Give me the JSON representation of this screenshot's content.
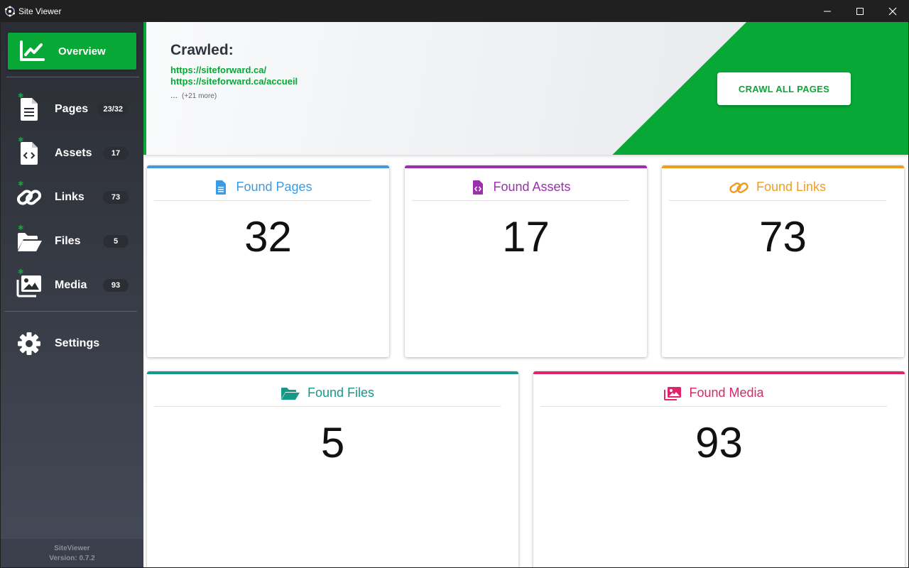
{
  "window": {
    "title": "Site Viewer",
    "controls": {
      "minimize": "—",
      "maximize": "☐",
      "close": "✕"
    }
  },
  "sidebar": {
    "active": {
      "label": "Overview",
      "icon": "chart-line-icon"
    },
    "items": [
      {
        "label": "Pages",
        "badge": "23/32",
        "icon": "file-icon"
      },
      {
        "label": "Assets",
        "badge": "17",
        "icon": "file-code-icon"
      },
      {
        "label": "Links",
        "badge": "73",
        "icon": "link-icon"
      },
      {
        "label": "Files",
        "badge": "5",
        "icon": "folder-open-icon"
      },
      {
        "label": "Media",
        "badge": "93",
        "icon": "images-icon"
      }
    ],
    "settings": {
      "label": "Settings",
      "icon": "gear-icon"
    },
    "footer": {
      "app": "SiteViewer",
      "version": "Version: 0.7.2"
    }
  },
  "hero": {
    "title": "Crawled:",
    "links": [
      "https://siteforward.ca/",
      "https://siteforward.ca/accueil"
    ],
    "more_dots": "...",
    "more": "(+21 more)",
    "button": "CRAWL ALL PAGES"
  },
  "cards": {
    "pages": {
      "title": "Found Pages",
      "value": "32",
      "color": "#3d9be3"
    },
    "assets": {
      "title": "Found Assets",
      "value": "17",
      "color": "#9b2fae"
    },
    "links": {
      "title": "Found Links",
      "value": "73",
      "color": "#f29c1f"
    },
    "files": {
      "title": "Found Files",
      "value": "5",
      "color": "#17998a"
    },
    "media": {
      "title": "Found Media",
      "value": "93",
      "color": "#e1246a"
    }
  },
  "colors": {
    "accent": "#08a836",
    "sidebar_bg": "#2a2d33"
  }
}
